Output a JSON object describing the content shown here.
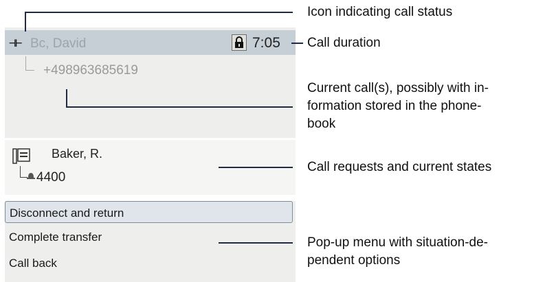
{
  "screen": {
    "call": {
      "status_icon": "⊣⊢",
      "caller_name": "Bc, David",
      "lock_icon": "padlock-icon",
      "duration": "7:05",
      "phone_number": "+498963685619"
    },
    "request": {
      "name": "Baker, R.",
      "number": "4400",
      "icons": [
        "phonebook-icon",
        "bell-icon"
      ]
    },
    "menu": {
      "items": [
        {
          "label": "Disconnect and return",
          "selected": true
        },
        {
          "label": "Complete transfer",
          "selected": false
        },
        {
          "label": "Call back",
          "selected": false
        }
      ]
    }
  },
  "annotations": {
    "status_icon": "Icon indicating call status",
    "duration": "Call duration",
    "current_call_1": "Current call(s), possibly with in-",
    "current_call_2": "formation stored in the phone-",
    "current_call_3": "book",
    "requests": "Call requests and current states",
    "popup_1": "Pop-up menu with situation-de-",
    "popup_2": "pendent options"
  },
  "colors": {
    "header_bg": "#c6cfd6",
    "panel_bg": "#eeeeec",
    "leader_line": "#1f2a44"
  }
}
